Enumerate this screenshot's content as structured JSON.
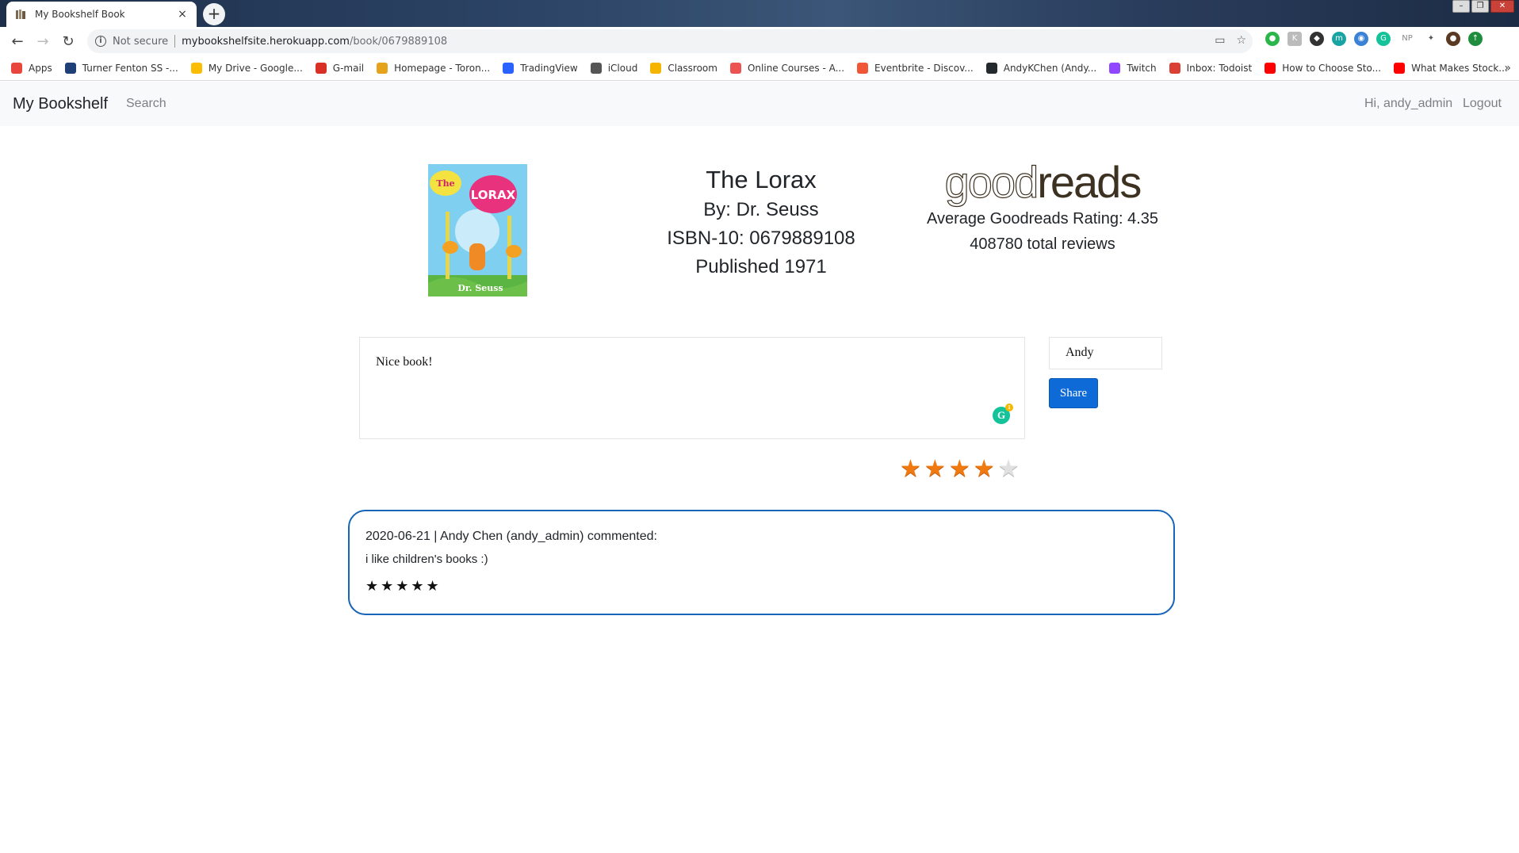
{
  "browser": {
    "tab_title": "My Bookshelf Book",
    "new_tab": "+",
    "close_tab": "×",
    "not_secure": "Not secure",
    "url_host": "mybookshelfsite.herokuapp.com",
    "url_path": "/book/0679889108",
    "bookmarks": [
      {
        "label": "Apps",
        "icon_color": "#e8453c"
      },
      {
        "label": "Turner Fenton SS -...",
        "icon_color": "#1f3f77"
      },
      {
        "label": "My Drive - Google...",
        "icon_color": "#fbbc04"
      },
      {
        "label": "G-mail",
        "icon_color": "#d93025"
      },
      {
        "label": "Homepage - Toron...",
        "icon_color": "#e5a21a"
      },
      {
        "label": "TradingView",
        "icon_color": "#2962ff"
      },
      {
        "label": "iCloud",
        "icon_color": "#555555"
      },
      {
        "label": "Classroom",
        "icon_color": "#f4b400"
      },
      {
        "label": "Online Courses - A...",
        "icon_color": "#ec5252"
      },
      {
        "label": "Eventbrite - Discov...",
        "icon_color": "#f05537"
      },
      {
        "label": "AndyKChen (Andy...",
        "icon_color": "#24292e"
      },
      {
        "label": "Twitch",
        "icon_color": "#9146ff"
      },
      {
        "label": "Inbox: Todoist",
        "icon_color": "#db4035"
      },
      {
        "label": "How to Choose Sto...",
        "icon_color": "#ff0000"
      },
      {
        "label": "What Makes Stock...",
        "icon_color": "#ff0000"
      }
    ],
    "bookmarks_more": "»"
  },
  "navbar": {
    "brand": "My Bookshelf",
    "search": "Search",
    "greeting": "Hi, andy_admin",
    "logout": "Logout"
  },
  "book": {
    "title": "The Lorax",
    "author": "By: Dr. Seuss",
    "isbn": "ISBN-10: 0679889108",
    "published": "Published 1971",
    "cover_title_small": "The",
    "cover_title_big": "LORAX",
    "cover_author": "Dr. Seuss"
  },
  "goodreads": {
    "logo_good": "good",
    "logo_reads": "reads",
    "avg_rating": "Average Goodreads Rating: 4.35",
    "total_reviews": "408780 total reviews"
  },
  "comment_form": {
    "comment_value": "Nice book!",
    "name_value": "Andy",
    "share_label": "Share",
    "grammarly_letter": "G",
    "rating": 4,
    "rating_max": 5
  },
  "reviews": [
    {
      "header": "2020-06-21 | Andy Chen (andy_admin) commented:",
      "body": "i like children's books :)",
      "stars": "★★★★★"
    }
  ]
}
